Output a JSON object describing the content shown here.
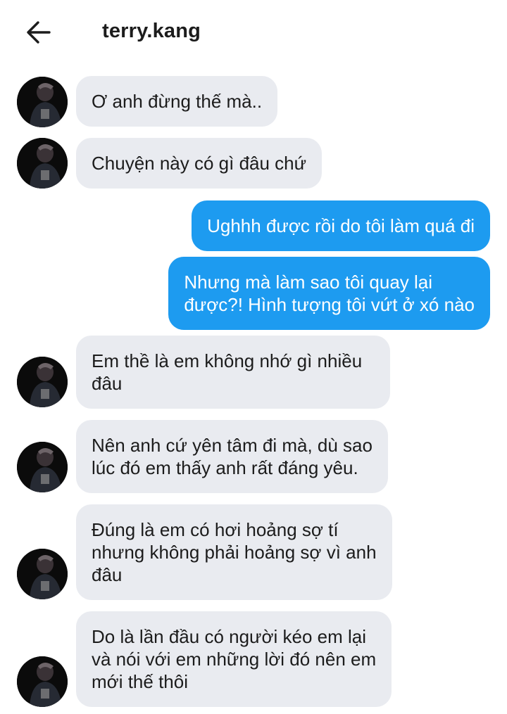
{
  "header": {
    "title": "terry.kang",
    "back_icon": "arrow-left-icon"
  },
  "colors": {
    "outgoing_bubble": "#1d9bf0",
    "incoming_bubble": "#e9ebf0",
    "text": "#1c1c1c"
  },
  "messages": [
    {
      "sender": "other",
      "text": "Ơ anh đừng thế mà.."
    },
    {
      "sender": "other",
      "text": "Chuyện này có gì đâu chứ"
    },
    {
      "sender": "me",
      "text": "Ughhh được rồi do tôi làm quá đi"
    },
    {
      "sender": "me",
      "text": "Nhưng mà làm sao tôi quay lại\nđược?! Hình tượng tôi vứt ở xó nào"
    },
    {
      "sender": "other",
      "text": "Em thề là em không nhớ gì nhiều\nđâu"
    },
    {
      "sender": "other",
      "text": "Nên anh cứ yên tâm đi mà, dù sao\nlúc đó em thấy anh rất đáng yêu."
    },
    {
      "sender": "other",
      "text": "Đúng là em có hơi hoảng sợ tí\nnhưng không phải hoảng sợ vì anh\nđâu"
    },
    {
      "sender": "other",
      "text": "Do là lần đầu có người kéo em lại\nvà nói với em những lời đó nên em\nmới thế thôi"
    }
  ]
}
